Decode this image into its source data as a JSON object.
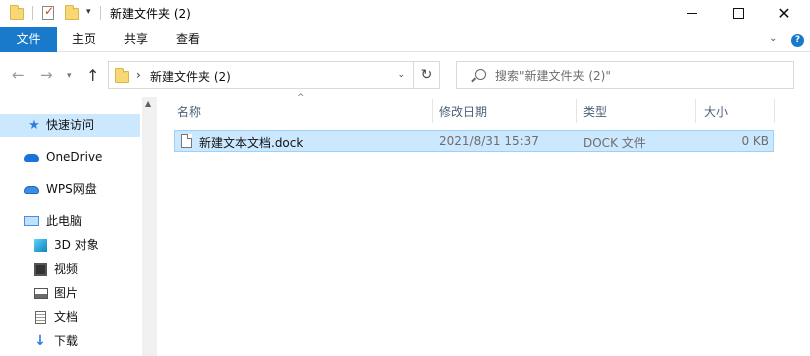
{
  "window": {
    "title": "新建文件夹 (2)"
  },
  "ribbon": {
    "tabs": [
      {
        "label": "文件"
      },
      {
        "label": "主页"
      },
      {
        "label": "共享"
      },
      {
        "label": "查看"
      }
    ]
  },
  "address": {
    "path": "新建文件夹 (2)"
  },
  "search": {
    "placeholder": "搜索\"新建文件夹 (2)\""
  },
  "sidebar": {
    "items": [
      {
        "label": "快速访问",
        "icon": "star-icon",
        "selected": true
      },
      {
        "label": "OneDrive",
        "icon": "onedrive-cloud-icon"
      },
      {
        "label": "WPS网盘",
        "icon": "wps-cloud-icon"
      },
      {
        "label": "此电脑",
        "icon": "pc-icon"
      },
      {
        "label": "3D 对象",
        "icon": "3d-objects-icon"
      },
      {
        "label": "视频",
        "icon": "video-icon"
      },
      {
        "label": "图片",
        "icon": "pictures-icon"
      },
      {
        "label": "文档",
        "icon": "documents-icon"
      },
      {
        "label": "下载",
        "icon": "download-icon"
      }
    ]
  },
  "list": {
    "columns": {
      "name": "名称",
      "date": "修改日期",
      "type": "类型",
      "size": "大小"
    },
    "rows": [
      {
        "name": "新建文本文档.dock",
        "date": "2021/8/31 15:37",
        "type": "DOCK 文件",
        "size": "0 KB",
        "selected": true
      }
    ]
  },
  "colors": {
    "accent": "#1979ca",
    "selection": "#cce8ff",
    "selection_border": "#99d1ff"
  }
}
